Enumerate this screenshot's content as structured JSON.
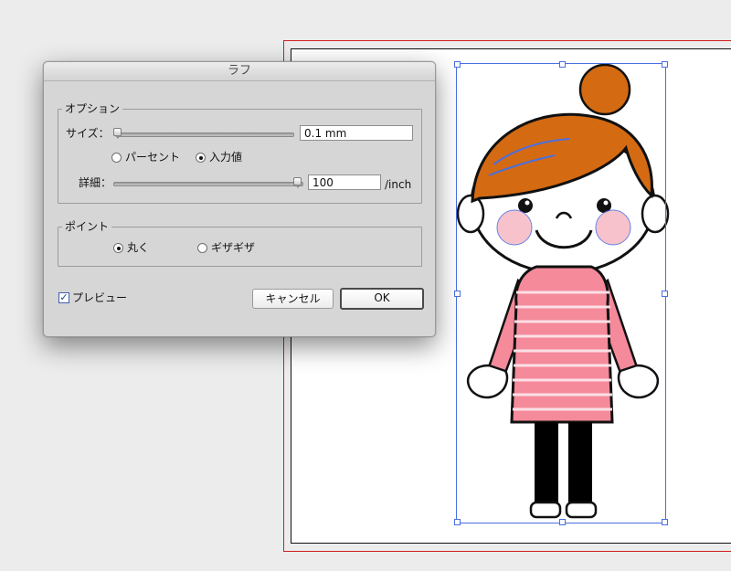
{
  "dialog": {
    "title": "ラフ",
    "options": {
      "legend": "オプション",
      "size_label": "サイズ：",
      "size_value": "0.1 mm",
      "size_slider_fraction": 0.0,
      "mode_percent_label": "パーセント",
      "mode_input_label": "入力値",
      "mode_selected": "入力値",
      "detail_label": "詳細：",
      "detail_value": "100",
      "detail_slider_fraction": 1.0,
      "detail_unit": "/inch"
    },
    "points": {
      "legend": "ポイント",
      "smooth_label": "丸く",
      "jagged_label": "ギザギザ",
      "selected": "丸く"
    },
    "preview": {
      "label": "プレビュー",
      "checked": true
    },
    "buttons": {
      "cancel": "キャンセル",
      "ok": "OK"
    }
  },
  "colors": {
    "artboard_bleed": "#d21f1f",
    "selection": "#4a6fe0",
    "hair": "#d46a12",
    "shirt": "#f58a9b",
    "cheek": "#f6b8c4",
    "legs": "#000000"
  }
}
